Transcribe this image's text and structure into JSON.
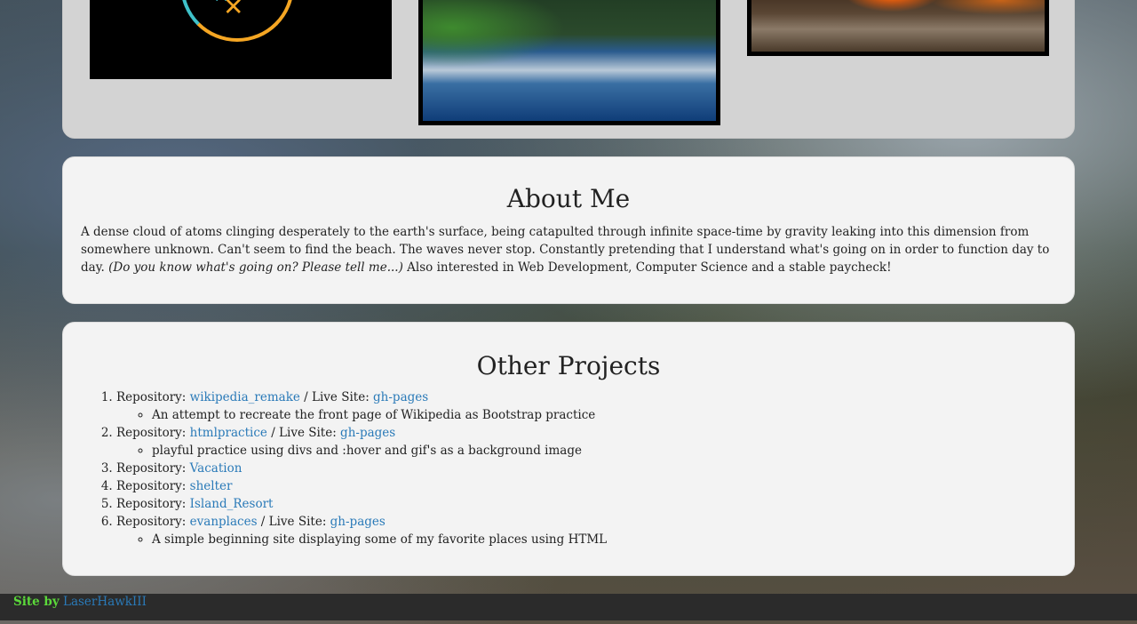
{
  "gallery": {
    "images": [
      {
        "name": "logo",
        "icon": "crossed-swords-logo"
      },
      {
        "name": "lake",
        "icon": "mountain-lake-photo"
      },
      {
        "name": "campfire",
        "icon": "campfire-photo"
      }
    ]
  },
  "about": {
    "title": "About Me",
    "text_part1": "A dense cloud of atoms clinging desperately to the earth's surface, being catapulted through infinite space-time by gravity leaking into this dimension from somewhere unknown. Can't seem to find the beach. The waves never stop. Constantly pretending that I understand what's going on in order to function day to day. ",
    "text_italic": "(Do you know what's going on? Please tell me...)",
    "text_part2": " Also interested in Web Development, Computer Science and a stable paycheck!"
  },
  "projects": {
    "title": "Other Projects",
    "repo_label": "Repository: ",
    "live_label": " / Live Site: ",
    "items": [
      {
        "repo": "wikipedia_remake",
        "live": "gh-pages",
        "desc": "An attempt to recreate the front page of Wikipedia as Bootstrap practice"
      },
      {
        "repo": "htmlpractice",
        "live": "gh-pages",
        "desc": "playful practice using divs and :hover and gif's as a background image"
      },
      {
        "repo": "Vacation"
      },
      {
        "repo": "shelter"
      },
      {
        "repo": "Island_Resort"
      },
      {
        "repo": "evanplaces",
        "live": "gh-pages",
        "desc": "A simple beginning site displaying some of my favorite places using HTML"
      }
    ]
  },
  "footer": {
    "site_by": "Site by",
    "author": "LaserHawkIII"
  },
  "colors": {
    "link": "#2a7ab8",
    "footer_accent": "#5bd93a",
    "panel_bg": "#f3f3f3"
  }
}
